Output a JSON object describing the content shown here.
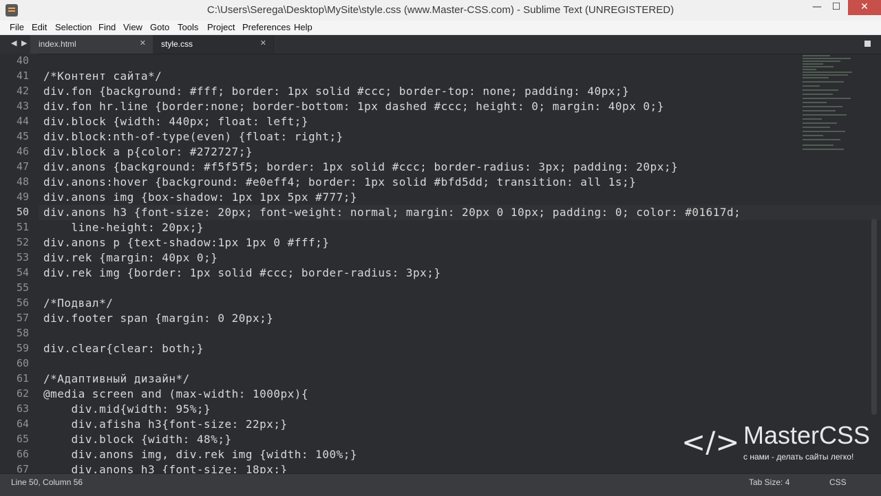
{
  "window": {
    "title": "C:\\Users\\Serega\\Desktop\\MySite\\style.css (www.Master-CSS.com) - Sublime Text (UNREGISTERED)",
    "minimize_glyph": "—",
    "maximize_glyph": "☐",
    "close_glyph": "✕"
  },
  "menu": [
    "File",
    "Edit",
    "Selection",
    "Find",
    "View",
    "Goto",
    "Tools",
    "Project",
    "Preferences",
    "Help"
  ],
  "tabs": [
    {
      "label": "index.html",
      "active": false
    },
    {
      "label": "style.css",
      "active": true
    }
  ],
  "tab_close_glyph": "✕",
  "nav_back_glyph": "◀",
  "nav_forward_glyph": "▶",
  "editor": {
    "current_line": 50,
    "lines": [
      {
        "num": "40",
        "text": ""
      },
      {
        "num": "41",
        "text": "/*Контент сайта*/"
      },
      {
        "num": "42",
        "text": "div.fon {background: #fff; border: 1px solid #ccc; border-top: none; padding: 40px;}"
      },
      {
        "num": "43",
        "text": "div.fon hr.line {border:none; border-bottom: 1px dashed #ccc; height: 0; margin: 40px 0;}"
      },
      {
        "num": "44",
        "text": "div.block {width: 440px; float: left;}"
      },
      {
        "num": "45",
        "text": "div.block:nth-of-type(even) {float: right;}"
      },
      {
        "num": "46",
        "text": "div.block a p{color: #272727;}"
      },
      {
        "num": "47",
        "text": "div.anons {background: #f5f5f5; border: 1px solid #ccc; border-radius: 3px; padding: 20px;}"
      },
      {
        "num": "48",
        "text": "div.anons:hover {background: #e0eff4; border: 1px solid #bfd5dd; transition: all 1s;}"
      },
      {
        "num": "49",
        "text": "div.anons img {box-shadow: 1px 1px 5px #777;}"
      },
      {
        "num": "50",
        "text": "div.anons h3 {font-size: 20px; font-weight: normal; margin: 20px 0 10px; padding: 0; color: #01617d;"
      },
      {
        "num": "51",
        "text": "    line-height: 20px;}"
      },
      {
        "num": "52",
        "text": "div.anons p {text-shadow:1px 1px 0 #fff;}"
      },
      {
        "num": "53",
        "text": "div.rek {margin: 40px 0;}"
      },
      {
        "num": "54",
        "text": "div.rek img {border: 1px solid #ccc; border-radius: 3px;}"
      },
      {
        "num": "55",
        "text": ""
      },
      {
        "num": "56",
        "text": "/*Подвал*/"
      },
      {
        "num": "57",
        "text": "div.footer span {margin: 0 20px;}"
      },
      {
        "num": "58",
        "text": ""
      },
      {
        "num": "59",
        "text": "div.clear{clear: both;}"
      },
      {
        "num": "60",
        "text": ""
      },
      {
        "num": "61",
        "text": "/*Адаптивный дизайн*/"
      },
      {
        "num": "62",
        "text": "@media screen and (max-width: 1000px){"
      },
      {
        "num": "63",
        "text": "    div.mid{width: 95%;}"
      },
      {
        "num": "64",
        "text": "    div.afisha h3{font-size: 22px;}"
      },
      {
        "num": "65",
        "text": "    div.block {width: 48%;}"
      },
      {
        "num": "66",
        "text": "    div.anons img, div.rek img {width: 100%;}"
      },
      {
        "num": "67",
        "text": "    div.anons h3 {font-size: 18px;}"
      }
    ]
  },
  "watermark": {
    "brackets": "</>",
    "name": "MasterCSS",
    "tagline": "с нами - делать сайты легко!"
  },
  "status": {
    "position": "Line 50, Column 56",
    "tab_size": "Tab Size: 4",
    "syntax": "CSS"
  },
  "colors": {
    "background": "#2b2d30",
    "text": "#d9d9d9",
    "line_numbers": "#8f9297",
    "close_button": "#c7504a"
  }
}
